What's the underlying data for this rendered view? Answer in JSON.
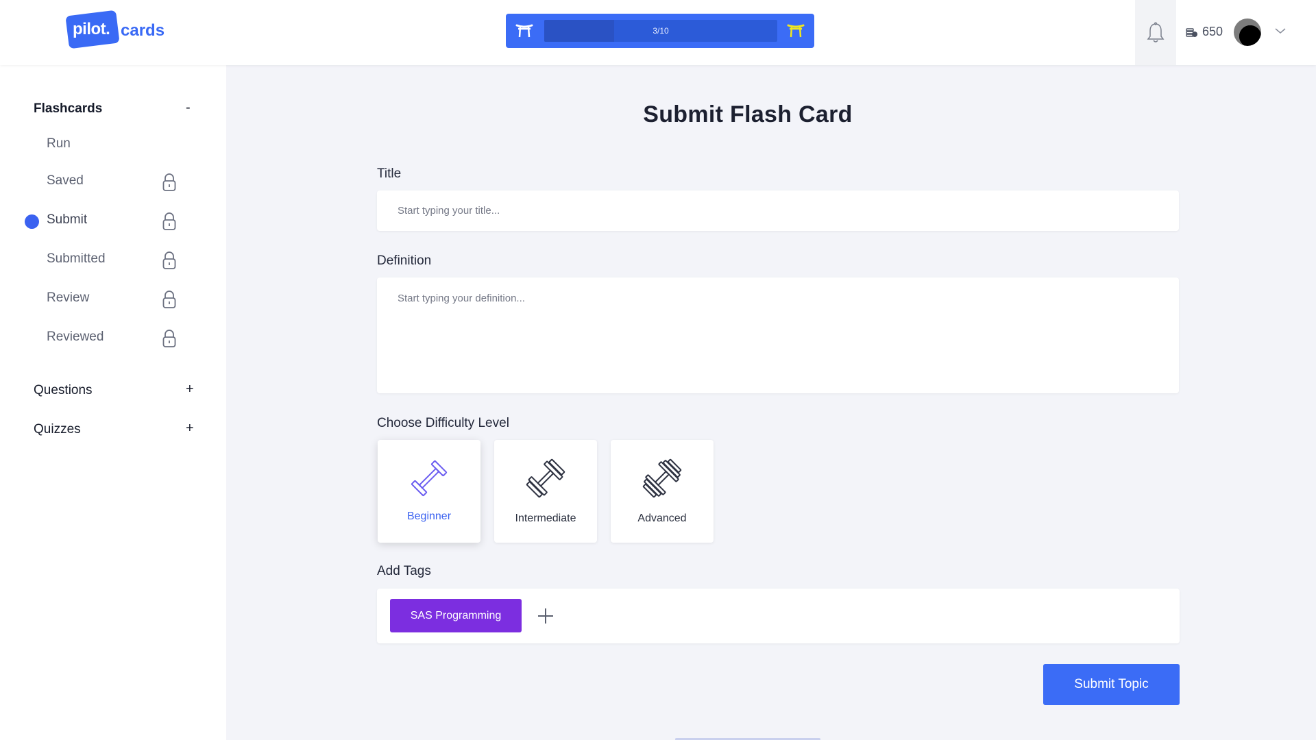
{
  "header": {
    "logo_pilot": "pilot.",
    "logo_cards": "cards",
    "progress_label": "3/10",
    "progress_fraction": 0.3,
    "coins": "650"
  },
  "sidebar": {
    "sections": [
      {
        "label": "Flashcards",
        "toggle": "-",
        "items": [
          {
            "label": "Run",
            "locked": false,
            "active": false
          },
          {
            "label": "Saved",
            "locked": true,
            "active": false
          },
          {
            "label": "Submit",
            "locked": true,
            "active": true
          },
          {
            "label": "Submitted",
            "locked": true,
            "active": false
          },
          {
            "label": "Review",
            "locked": true,
            "active": false
          },
          {
            "label": "Reviewed",
            "locked": true,
            "active": false
          }
        ]
      },
      {
        "label": "Questions",
        "toggle": "+"
      },
      {
        "label": "Quizzes",
        "toggle": "+"
      }
    ]
  },
  "main": {
    "title": "Submit Flash Card",
    "title_field": {
      "label": "Title",
      "placeholder": "Start typing your title...",
      "value": ""
    },
    "definition_field": {
      "label": "Definition",
      "placeholder": "Start typing your definition...",
      "value": ""
    },
    "difficulty": {
      "label": "Choose Difficulty Level",
      "options": [
        {
          "label": "Beginner",
          "selected": true,
          "icon": "dumbbell-icon"
        },
        {
          "label": "Intermediate",
          "selected": false,
          "icon": "dumbbell-icon"
        },
        {
          "label": "Advanced",
          "selected": false,
          "icon": "dumbbell-icon"
        }
      ]
    },
    "tags": {
      "label": "Add Tags",
      "items": [
        "SAS Programming"
      ]
    },
    "submit_label": "Submit Topic"
  },
  "colors": {
    "accent": "#3b6cf6",
    "tag": "#7c2ee0",
    "sidebar_dot": "#3b62f0"
  }
}
